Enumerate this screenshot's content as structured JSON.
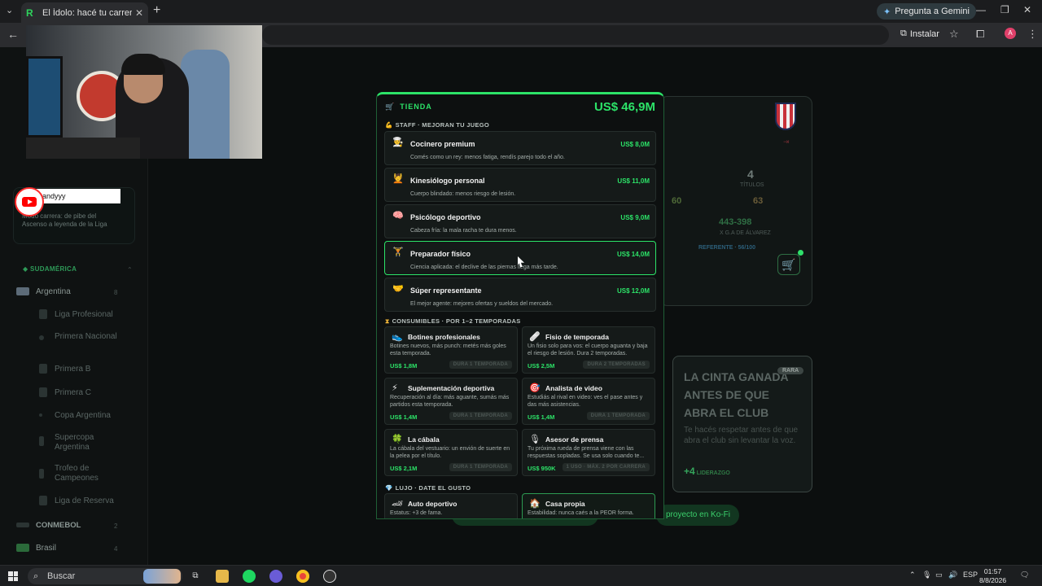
{
  "browser": {
    "tab_title": "El Ídolo: hacé tu carrera en la L",
    "tab_favicon": "R",
    "tab_close": "✕",
    "new_tab": "+",
    "gemini_label": "Pregunta a Gemini",
    "install_label": "Instalar",
    "profile_initial": "A"
  },
  "sidebar": {
    "video_user": "andyyy",
    "card_desc": "Modo carrera: de pibe del Ascenso a leyenda de la Liga",
    "sections": [
      {
        "label": "SUDAMÉRICA"
      },
      {
        "label": "Argentina",
        "count": "8"
      },
      {
        "label": "CONMEBOL",
        "count": "2"
      },
      {
        "label": "Brasil",
        "count": "4"
      }
    ],
    "items": [
      "Liga Profesional",
      "Primera Nacional",
      "Primera B",
      "Primera C",
      "Copa Argentina",
      "Supercopa Argentina",
      "Trofeo de Campeones",
      "Liga de Reserva"
    ]
  },
  "background": {
    "titles_value": "4",
    "titles_label": "TÍTULOS",
    "stat_left": "60",
    "stat_right": "63",
    "record": "443-398",
    "record_sub": "X G.A DE ÁLVAREZ",
    "referente": "REFERENTE · 56/100",
    "cinta_title": "LA CINTA GANADA ANTES DE QUE ABRA EL CLUB",
    "cinta_badge": "RARA",
    "cinta_desc": "Te hacés respetar antes de que abra el club sin levantar la voz.",
    "cinta_bonus_value": "+4",
    "cinta_bonus_label": "LIDERAZGO",
    "kofi_label": "proyecto en Ko-Fi"
  },
  "shop": {
    "title": "TIENDA",
    "balance": "US$ 46,9M",
    "staff_section": "STAFF · MEJORAN TU JUEGO",
    "staff": [
      {
        "icon": "chef-icon",
        "glyph": "👨‍🍳",
        "name": "Cocinero premium",
        "price": "US$ 8,0M",
        "desc": "Comés como un rey: menos fatiga, rendís parejo todo el año."
      },
      {
        "icon": "physio-icon",
        "glyph": "💆",
        "name": "Kinesiólogo personal",
        "price": "US$ 11,0M",
        "desc": "Cuerpo blindado: menos riesgo de lesión."
      },
      {
        "icon": "brain-icon",
        "glyph": "🧠",
        "name": "Psicólogo deportivo",
        "price": "US$ 9,0M",
        "desc": "Cabeza fría: la mala racha te dura menos."
      },
      {
        "icon": "weightlifter-icon",
        "glyph": "🏋",
        "name": "Preparador físico",
        "price": "US$ 14,0M",
        "desc": "Ciencia aplicada: el declive de las piernas llega más tarde."
      },
      {
        "icon": "handshake-icon",
        "glyph": "🤝",
        "name": "Súper representante",
        "price": "US$ 12,0M",
        "desc": "El mejor agente: mejores ofertas y sueldos del mercado."
      }
    ],
    "consumables_section": "CONSUMIBLES · POR 1–2 TEMPORADAS",
    "consumables": [
      {
        "icon": "boot-icon",
        "glyph": "👟",
        "name": "Botines profesionales",
        "desc": "Botines nuevos, más punch: metés más goles esta temporada.",
        "price": "US$ 1,8M",
        "duration": "DURA 1 TEMPORADA"
      },
      {
        "icon": "bandage-icon",
        "glyph": "🩹",
        "name": "Fisio de temporada",
        "desc": "Un fisio solo para vos: el cuerpo aguanta y baja el riesgo de lesión. Dura 2 temporadas.",
        "price": "US$ 2,5M",
        "duration": "DURA 2 TEMPORADAS"
      },
      {
        "icon": "lightning-icon",
        "glyph": "⚡",
        "name": "Suplementación deportiva",
        "desc": "Recuperación al día: más aguante, sumás más partidos esta temporada.",
        "price": "US$ 1,4M",
        "duration": "DURA 1 TEMPORADA"
      },
      {
        "icon": "target-icon",
        "glyph": "🎯",
        "name": "Analista de video",
        "desc": "Estudiás al rival en video: ves el pase antes y das más asistencias.",
        "price": "US$ 1,4M",
        "duration": "DURA 1 TEMPORADA"
      },
      {
        "icon": "clover-icon",
        "glyph": "🍀",
        "name": "La cábala",
        "desc": "La cábala del vestuario: un envión de suerte en la pelea por el título.",
        "price": "US$ 2,1M",
        "duration": "DURA 1 TEMPORADA"
      },
      {
        "icon": "microphone-icon",
        "glyph": "🎙",
        "name": "Asesor de prensa",
        "desc": "Tu próxima rueda de prensa viene con las respuestas sopladas. Se usa solo cuando te...",
        "price": "US$ 950K",
        "duration": "1 USO · MÁX. 2 POR CARRERA"
      }
    ],
    "luxury_section": "LUJO · DATE EL GUSTO",
    "luxury": [
      {
        "icon": "car-icon",
        "glyph": "🏎",
        "name": "Auto deportivo",
        "desc": "Estatus: +3 de fama."
      },
      {
        "icon": "house-icon",
        "glyph": "🏠",
        "name": "Casa propia",
        "desc": "Estabilidad: nunca caés a la PEOR forma."
      }
    ]
  },
  "taskbar": {
    "search_label": "Buscar",
    "lang": "ESP",
    "time": "01:57",
    "date": "8/8/2026"
  }
}
